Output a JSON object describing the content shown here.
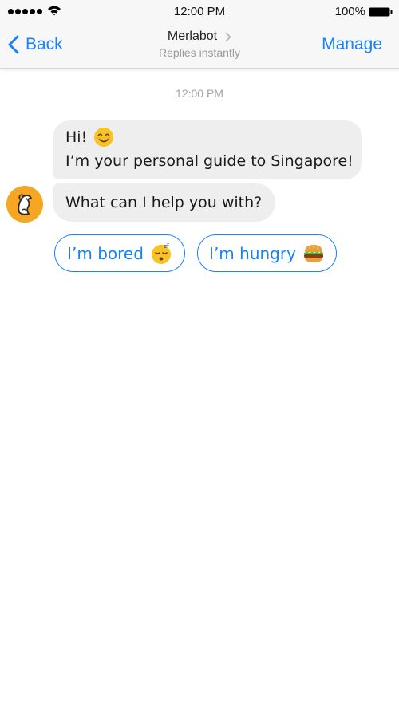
{
  "status_bar": {
    "time": "12:00 PM",
    "battery": "100%"
  },
  "nav": {
    "back_label": "Back",
    "bot_name": "Merlabot",
    "bot_subtitle": "Replies instantly",
    "manage_label": "Manage"
  },
  "chat": {
    "timestamp": "12:00 PM",
    "messages": [
      {
        "line1": "Hi!",
        "line1_icon": "smiling-face-icon",
        "line2": "I’m your personal guide to Singapore!"
      },
      {
        "text": "What can I help you with?"
      }
    ],
    "quick_replies": [
      {
        "label": "I’m bored",
        "icon": "sleeping-face-icon"
      },
      {
        "label": "I’m hungry",
        "icon": "hamburger-icon"
      }
    ]
  },
  "colors": {
    "accent": "#1b82f5",
    "bubble": "#eeeeee",
    "avatar": "#f5a623"
  }
}
